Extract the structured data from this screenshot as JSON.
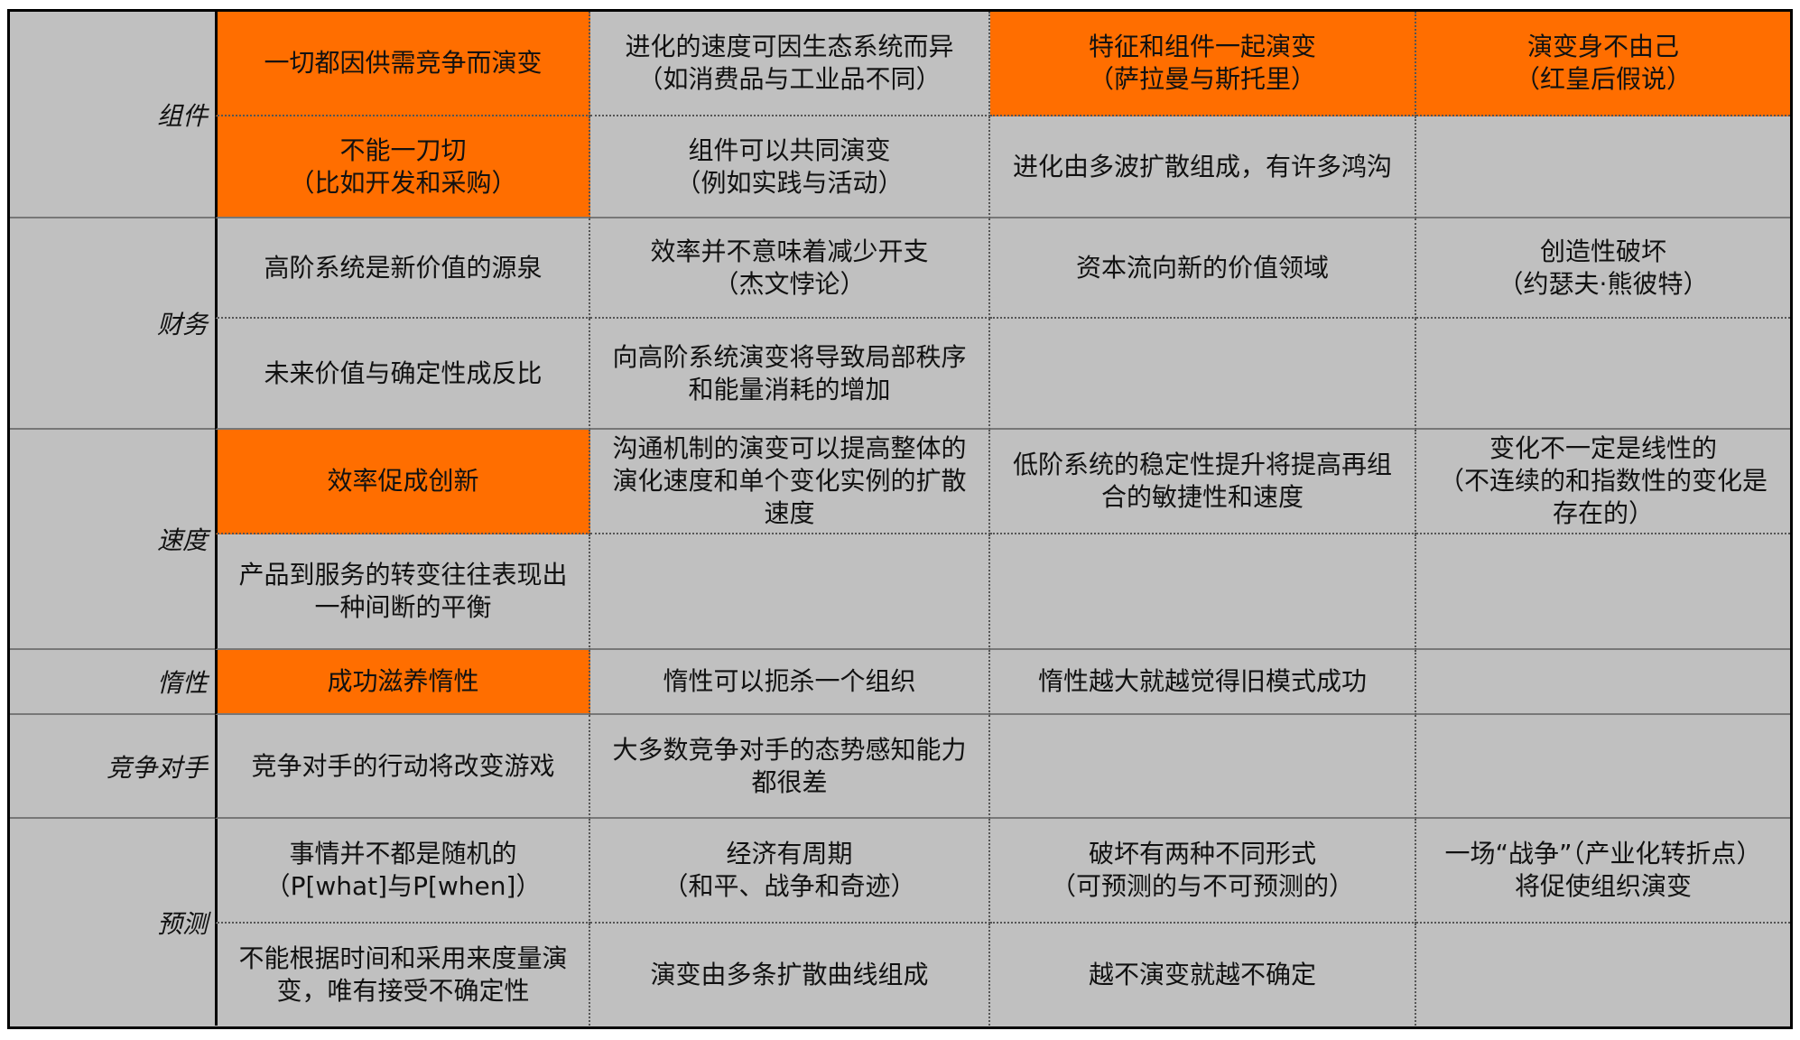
{
  "colors": {
    "highlight": "#ff6e00",
    "cell": "#c0c0c0",
    "border": "#000000"
  },
  "categories": [
    "组件",
    "财务",
    "速度",
    "惰性",
    "竞争对手",
    "预测"
  ],
  "rows": [
    {
      "cells": [
        {
          "text": "一切都因供需竞争而演变",
          "highlight": true
        },
        {
          "text": "进化的速度可因生态系统而异\n（如消费品与工业品不同）",
          "highlight": false
        },
        {
          "text": "特征和组件一起演变\n（萨拉曼与斯托里）",
          "highlight": true
        },
        {
          "text": "演变身不由己\n（红皇后假说）",
          "highlight": true
        }
      ]
    },
    {
      "cells": [
        {
          "text": "不能一刀切\n（比如开发和采购）",
          "highlight": true
        },
        {
          "text": "组件可以共同演变\n（例如实践与活动）",
          "highlight": false
        },
        {
          "text": "进化由多波扩散组成，有许多鸿沟",
          "highlight": false
        },
        {
          "text": "",
          "highlight": false
        }
      ]
    },
    {
      "cells": [
        {
          "text": "高阶系统是新价值的源泉",
          "highlight": false
        },
        {
          "text": "效率并不意味着减少开支\n（杰文悖论）",
          "highlight": false
        },
        {
          "text": "资本流向新的价值领域",
          "highlight": false
        },
        {
          "text": "创造性破坏\n（约瑟夫·熊彼特）",
          "highlight": false
        }
      ]
    },
    {
      "cells": [
        {
          "text": "未来价值与确定性成反比",
          "highlight": false
        },
        {
          "text": "向高阶系统演变将导致局部秩序\n和能量消耗的增加",
          "highlight": false
        },
        {
          "text": "",
          "highlight": false
        },
        {
          "text": "",
          "highlight": false
        }
      ]
    },
    {
      "cells": [
        {
          "text": "效率促成创新",
          "highlight": true
        },
        {
          "text": "沟通机制的演变可以提高整体的\n演化速度和单个变化实例的扩散\n速度",
          "highlight": false
        },
        {
          "text": "低阶系统的稳定性提升将提高再组\n合的敏捷性和速度",
          "highlight": false
        },
        {
          "text": "变化不一定是线性的\n（不连续的和指数性的变化是\n存在的）",
          "highlight": false
        }
      ]
    },
    {
      "cells": [
        {
          "text": "产品到服务的转变往往表现出\n一种间断的平衡",
          "highlight": false
        },
        {
          "text": "",
          "highlight": false
        },
        {
          "text": "",
          "highlight": false
        },
        {
          "text": "",
          "highlight": false
        }
      ]
    },
    {
      "cells": [
        {
          "text": "成功滋养惰性",
          "highlight": true
        },
        {
          "text": "惰性可以扼杀一个组织",
          "highlight": false
        },
        {
          "text": "惰性越大就越觉得旧模式成功",
          "highlight": false
        },
        {
          "text": "",
          "highlight": false
        }
      ]
    },
    {
      "cells": [
        {
          "text": "竞争对手的行动将改变游戏",
          "highlight": false
        },
        {
          "text": "大多数竞争对手的态势感知能力\n都很差",
          "highlight": false
        },
        {
          "text": "",
          "highlight": false
        },
        {
          "text": "",
          "highlight": false
        }
      ]
    },
    {
      "cells": [
        {
          "text": "事情并不都是随机的\n（P[what]与P[when]）",
          "highlight": false
        },
        {
          "text": "经济有周期\n（和平、战争和奇迹）",
          "highlight": false
        },
        {
          "text": "破坏有两种不同形式\n（可预测的与不可预测的）",
          "highlight": false
        },
        {
          "text": "一场“战争”（产业化转折点）\n将促使组织演变",
          "highlight": false
        }
      ]
    },
    {
      "cells": [
        {
          "text": "不能根据时间和采用来度量演\n变，唯有接受不确定性",
          "highlight": false
        },
        {
          "text": "演变由多条扩散曲线组成",
          "highlight": false
        },
        {
          "text": "越不演变就越不确定",
          "highlight": false
        },
        {
          "text": "",
          "highlight": false
        }
      ]
    }
  ]
}
